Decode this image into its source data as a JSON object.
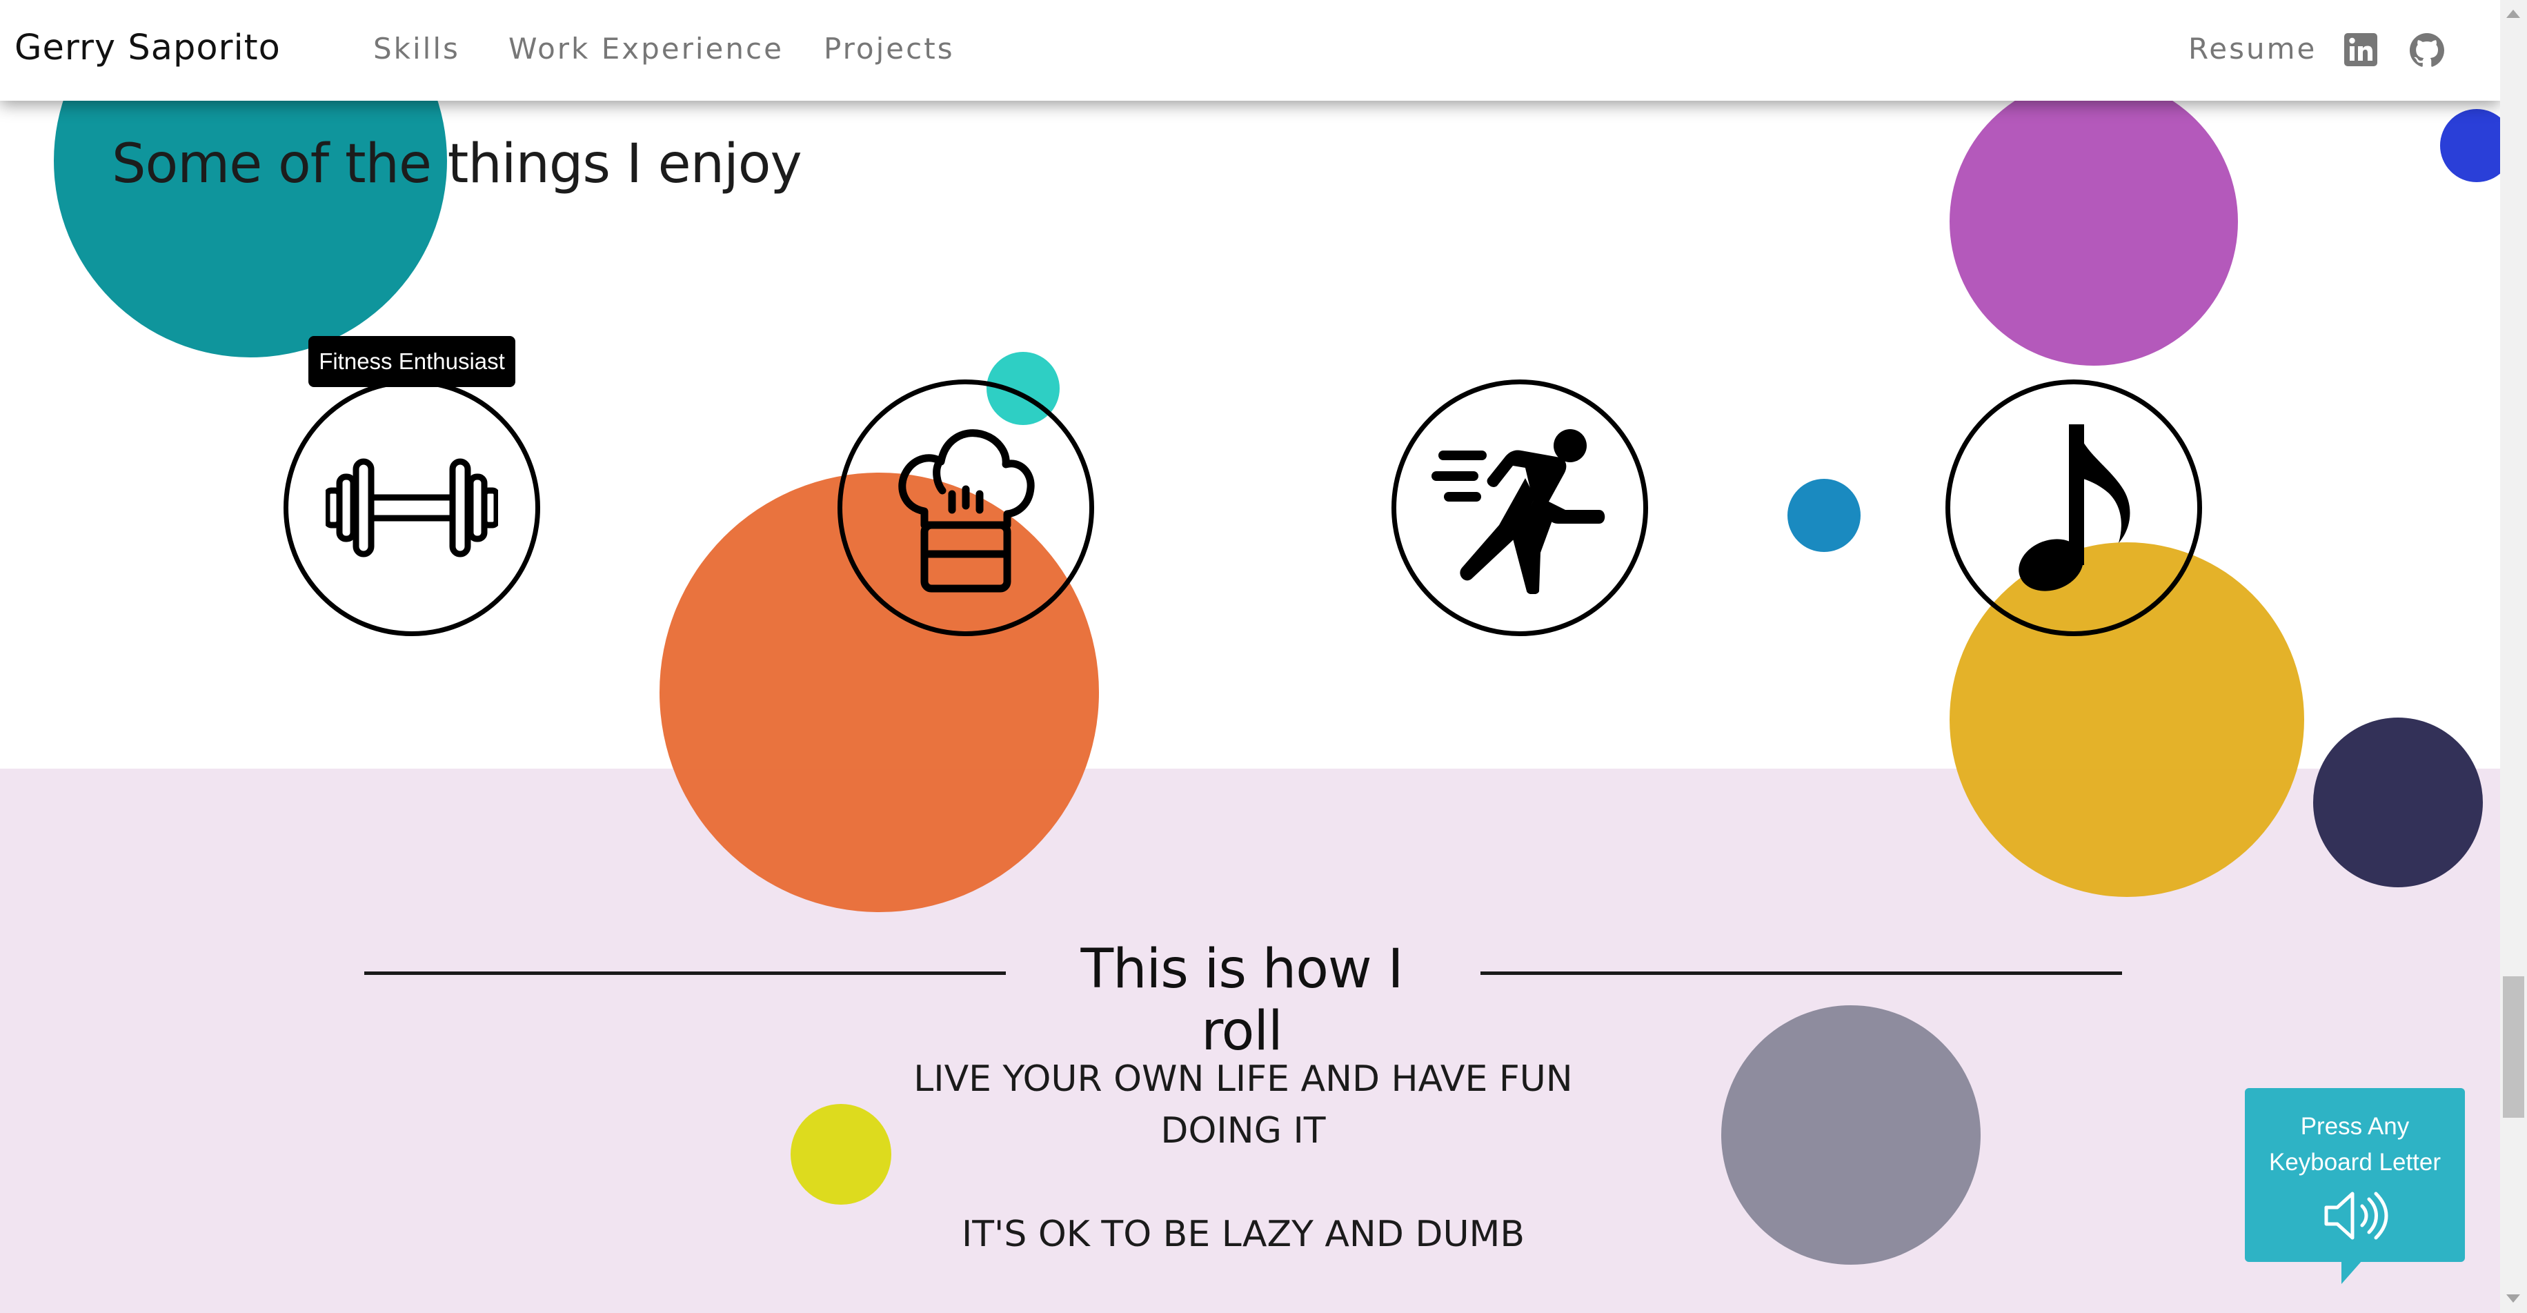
{
  "navbar": {
    "brand": "Gerry Saporito",
    "links": [
      {
        "label": "Skills"
      },
      {
        "label": "Work Experience"
      },
      {
        "label": "Projects"
      }
    ],
    "resume_label": "Resume",
    "social_icons": [
      "linkedin-icon",
      "github-icon"
    ]
  },
  "interests": {
    "heading": "Some of the things I enjoy",
    "tooltip": "Fitness Enthusiast",
    "hobbies": [
      {
        "icon": "dumbbell-icon"
      },
      {
        "icon": "chef-hat-icon"
      },
      {
        "icon": "running-person-icon"
      },
      {
        "icon": "music-note-icon"
      }
    ]
  },
  "motto": {
    "heading": "This is how I roll",
    "line1a": "LIVE YOUR OWN LIFE AND HAVE FUN",
    "line1b": "DOING IT",
    "line2": "IT'S OK TO BE LAZY AND DUMB"
  },
  "keyboard_hint": {
    "line1": "Press Any",
    "line2": "Keyboard Letter",
    "icon": "speaker-icon"
  },
  "colors": {
    "teal": "#0f959c",
    "purple": "#b050b7",
    "blue": "#2a3fd8",
    "aqua": "#2ecfc4",
    "orange": "#e86b34",
    "skyblue": "#1a8ac0",
    "gold": "#e3ae1e",
    "navy": "#333158",
    "yellow": "#dddb1e",
    "gray": "#8e8c9e",
    "lavender": "#f1e4f1",
    "hint": "#2eb3c5"
  }
}
